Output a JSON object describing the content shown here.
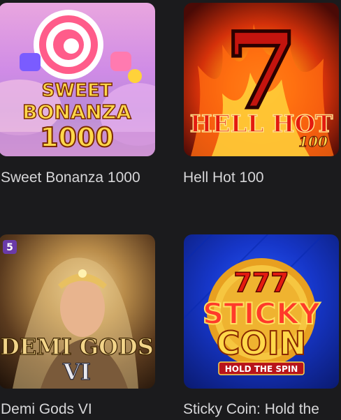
{
  "games": [
    {
      "title": "Sweet Bonanza 1000",
      "art_lines": [
        "SWEET",
        "BONANZA",
        "1000"
      ]
    },
    {
      "title": "Hell Hot 100",
      "art_lines": [
        "7",
        "HELL HOT",
        "100"
      ]
    },
    {
      "title": "Demi Gods VI",
      "art_lines": [
        "DEMI GODS",
        "VI"
      ],
      "provider_badge": "5"
    },
    {
      "title": "Sticky Coin: Hold the",
      "art_lines": [
        "777",
        "STICKY",
        "COIN",
        "HOLD THE SPIN"
      ]
    }
  ],
  "colors": {
    "background": "#1b1b1d",
    "caption_text": "#d6d6d8"
  }
}
